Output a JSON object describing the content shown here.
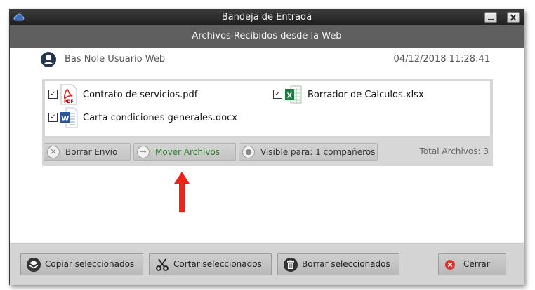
{
  "window": {
    "title": "Bandeja de Entrada",
    "subtitle": "Archivos Recibidos desde la Web"
  },
  "sender": {
    "name": "Bas Nole Usuario Web",
    "datetime": "04/12/2018 11:28:41"
  },
  "files": [
    {
      "name": "Contrato de servicios.pdf",
      "checked": true,
      "icon": "pdf-file-icon"
    },
    {
      "name": "Borrador de Cálculos.xlsx",
      "checked": true,
      "icon": "excel-file-icon"
    },
    {
      "name": "Carta condiciones generales.docx",
      "checked": true,
      "icon": "word-file-icon"
    }
  ],
  "actions": {
    "delete_send": "Borrar Envío",
    "move_files": "Mover Archivos",
    "visible_for": "Visible para: 1 compañeros",
    "total_files": "Total Archivos: 3"
  },
  "footer": {
    "copy": "Copiar seleccionados",
    "cut": "Cortar seleccionados",
    "delete": "Borrar seleccionados",
    "close": "Cerrar"
  },
  "colors": {
    "title_bar": "#2a2a2a",
    "subheader": "#5f5f5f",
    "move_label": "#2f7d2f",
    "arrow": "#e8261b",
    "close_icon": "#d9342b"
  }
}
